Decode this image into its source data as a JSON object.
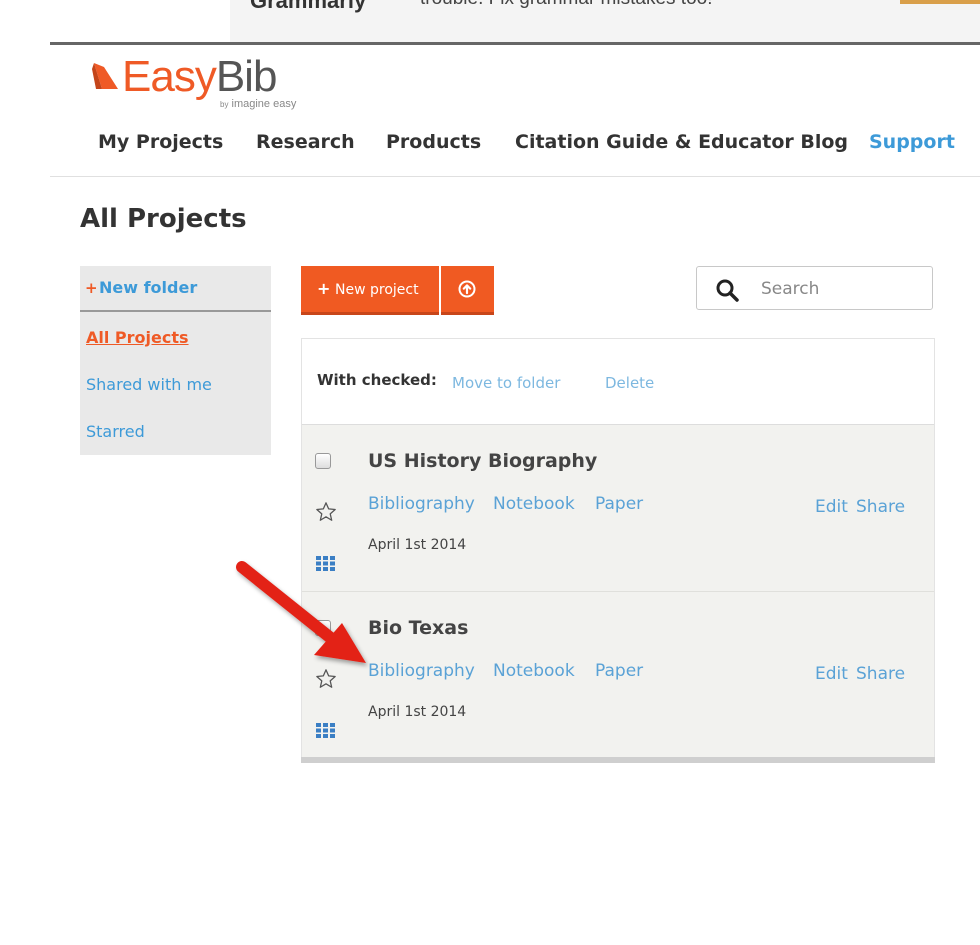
{
  "ad": {
    "logo": "Grammarly",
    "text": "trouble. Fix grammar mistakes too!"
  },
  "logo": {
    "easy": "Easy",
    "bib": "Bib",
    "by": "by",
    "company": "imagine easy",
    "accent_color": "#ef5a26"
  },
  "nav": {
    "items": [
      "My Projects",
      "Research",
      "Products",
      "Citation Guide & Educator Blog",
      "Support"
    ]
  },
  "page": {
    "title": "All Projects"
  },
  "sidebar": {
    "new_folder_label": "New folder",
    "links": [
      "All Projects",
      "Shared with me",
      "Starred"
    ]
  },
  "toolbar": {
    "new_project_label": "New project",
    "upload_icon": "upload-icon"
  },
  "search": {
    "placeholder": "Search"
  },
  "bulk": {
    "label": "With checked:",
    "move_to_folder": "Move to folder",
    "delete": "Delete"
  },
  "projects": [
    {
      "title": "US History Biography",
      "tabs": [
        "Bibliography",
        "Notebook",
        "Paper"
      ],
      "edit": "Edit",
      "share": "Share",
      "date": "April 1st 2014"
    },
    {
      "title": "Bio Texas",
      "tabs": [
        "Bibliography",
        "Notebook",
        "Paper"
      ],
      "edit": "Edit",
      "share": "Share",
      "date": "April 1st 2014"
    }
  ],
  "colors": {
    "accent": "#f05a22",
    "link": "#3d9ad8",
    "row_bg": "#f2f2ef",
    "annotation_arrow": "#e32119"
  }
}
